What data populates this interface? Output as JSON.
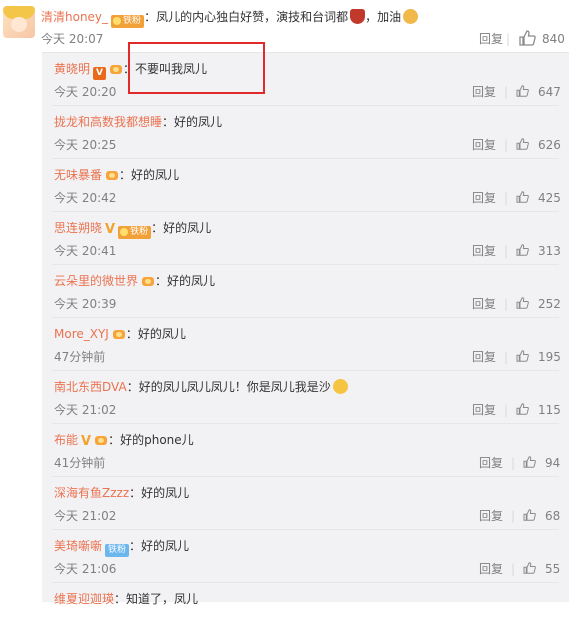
{
  "top_comment": {
    "username": "清清honey_",
    "badge": "铁粉",
    "separator": "：",
    "text": "凤儿的内心独白好赞，演技和台词都",
    "text_tail": "，加油",
    "time": "今天 20:07",
    "reply_label": "回复",
    "like_count": "840"
  },
  "replies": [
    {
      "username": "黄晓明",
      "badges": [
        "v",
        "crown"
      ],
      "text": "不要叫我凤儿",
      "time": "今天 20:20",
      "reply_label": "回复",
      "like_count": "647"
    },
    {
      "username": "拢龙和高数我都想睡",
      "badges": [],
      "text": "好的凤儿",
      "time": "今天 20:25",
      "reply_label": "回复",
      "like_count": "626"
    },
    {
      "username": "无味暴番",
      "badges": [
        "crown"
      ],
      "text": "好的凤儿",
      "time": "今天 20:42",
      "reply_label": "回复",
      "like_count": "425"
    },
    {
      "username": "思连朔晓",
      "badges": [
        "vgold",
        "vip"
      ],
      "vip_label": "铁粉",
      "text": "好的凤儿",
      "time": "今天 20:41",
      "reply_label": "回复",
      "like_count": "313"
    },
    {
      "username": "云朵里的微世界",
      "badges": [
        "crown"
      ],
      "text": "好的凤儿",
      "time": "今天 20:39",
      "reply_label": "回复",
      "like_count": "252"
    },
    {
      "username": "More_XYJ",
      "badges": [
        "crown"
      ],
      "text": "好的凤儿",
      "time": "47分钟前",
      "reply_label": "回复",
      "like_count": "195"
    },
    {
      "username": "南北东西DVA",
      "badges": [],
      "text": "好的凤儿凤儿凤儿！你是凤儿我是沙",
      "time": "今天 21:02",
      "reply_label": "回复",
      "like_count": "115"
    },
    {
      "username": "布能",
      "badges": [
        "vgold",
        "crown"
      ],
      "text": "好的phone儿",
      "time": "41分钟前",
      "reply_label": "回复",
      "like_count": "94"
    },
    {
      "username": "深海有鱼Zzzz",
      "badges": [],
      "text": "好的凤儿",
      "time": "今天 21:02",
      "reply_label": "回复",
      "like_count": "68"
    },
    {
      "username": "美琦噺噺",
      "badges": [
        "fan"
      ],
      "fan_label": "铁粉",
      "text": "好的凤儿",
      "time": "今天 21:06",
      "reply_label": "回复",
      "like_count": "55"
    },
    {
      "username": "维夏迎迦瑛",
      "badges": [],
      "text": "知道了，凤儿",
      "time": "",
      "reply_label": "",
      "like_count": ""
    }
  ],
  "colors": {
    "name": "#eb7350",
    "meta": "#808080",
    "panel": "#f2f2f5",
    "highlight": "#e12b2b"
  }
}
